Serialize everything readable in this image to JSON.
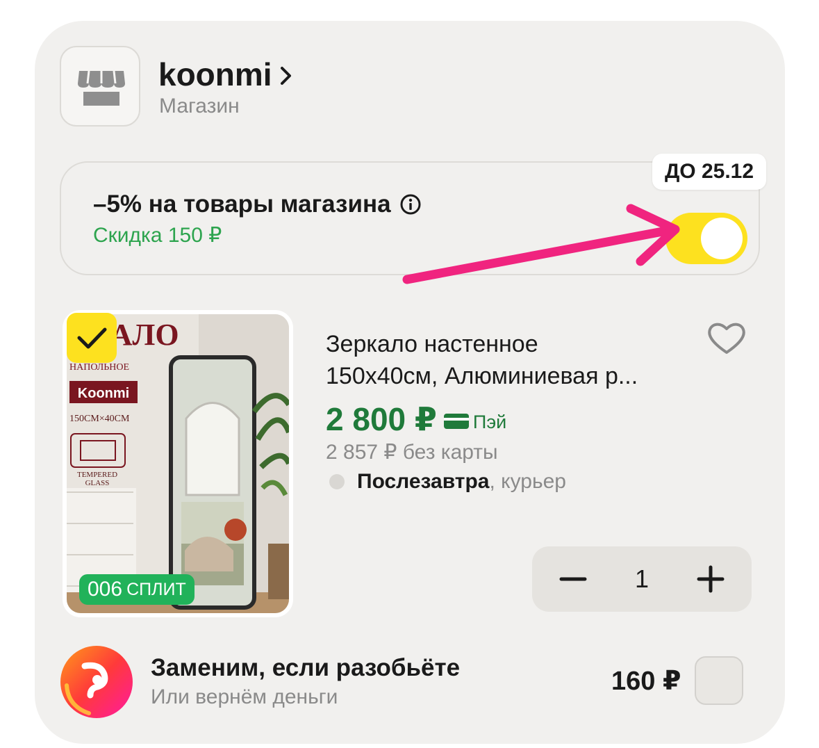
{
  "store": {
    "name": "koonmi",
    "subtitle": "Магазин",
    "logo_icon": "storefront-icon"
  },
  "promo": {
    "title": "–5% на товары магазина",
    "discount": "Скидка 150 ₽",
    "badge": "ДО 25.12",
    "toggle_on": true,
    "info_icon": "info-icon"
  },
  "product": {
    "title_line1": "Зеркало настенное",
    "title_line2": "150х40см, Алюминиевая р...",
    "price": "2 800 ₽",
    "pay_label": "Пэй",
    "price_no_card": "2 857 ₽  без карты",
    "delivery_day": "Послезавтра",
    "delivery_method": ", курьер",
    "selected": true,
    "quantity": "1",
    "split_amount": "006",
    "split_label": "СПЛИТ",
    "image": {
      "headline": "РКАЛО",
      "subline": "НАПОЛЬНОЕ",
      "brand": "Koonmi",
      "size": "150CM×40CM",
      "glass_line1": "TEMPERED",
      "glass_line2": "GLASS"
    }
  },
  "insurance": {
    "title": "Заменим, если разобьёте",
    "subtitle": "Или вернём деньги",
    "price": "160 ₽",
    "checked": false
  },
  "colors": {
    "accent_yellow": "#fde11f",
    "price_green": "#1f7a3a",
    "discount_green": "#2da44e",
    "arrow_pink": "#f0247f"
  }
}
